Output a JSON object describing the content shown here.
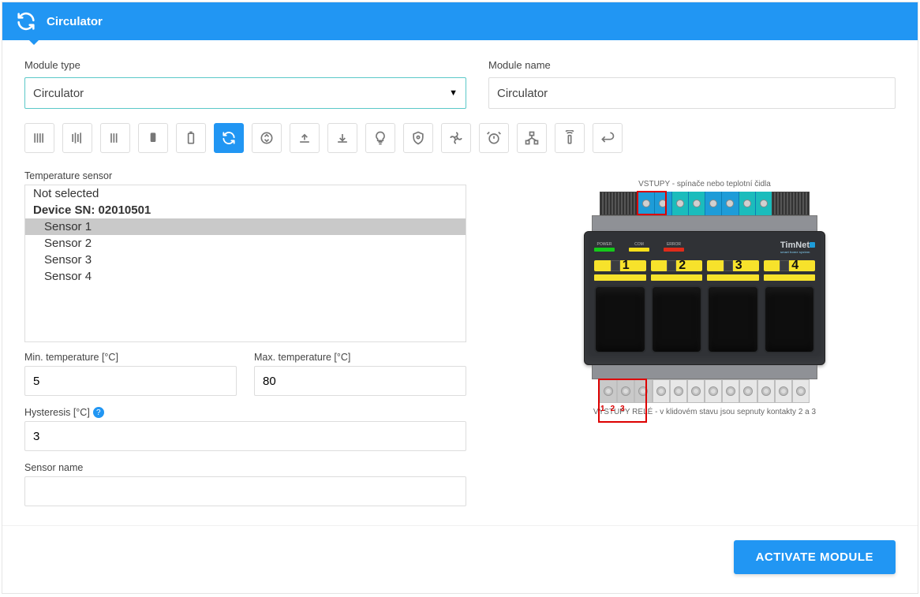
{
  "header": {
    "title": "Circulator"
  },
  "module_type": {
    "label": "Module type",
    "value": "Circulator"
  },
  "module_name": {
    "label": "Module name",
    "value": "Circulator"
  },
  "icons": [
    "barcode-a",
    "barcode-b",
    "barcode-c",
    "device",
    "battery",
    "cycle",
    "updown",
    "upload",
    "download",
    "bulb",
    "shield",
    "fan",
    "alarm",
    "network",
    "remote",
    "return"
  ],
  "selected_icon_index": 5,
  "sensor": {
    "label": "Temperature sensor",
    "rows": [
      {
        "text": "Not selected",
        "type": "row"
      },
      {
        "text": "Device SN: 02010501",
        "type": "group"
      },
      {
        "text": "Sensor 1",
        "type": "child",
        "selected": true
      },
      {
        "text": "Sensor 2",
        "type": "child"
      },
      {
        "text": "Sensor 3",
        "type": "child"
      },
      {
        "text": "Sensor 4",
        "type": "child"
      }
    ]
  },
  "min_t": {
    "label": "Min. temperature [°C]",
    "value": "5"
  },
  "max_t": {
    "label": "Max. temperature [°C]",
    "value": "80"
  },
  "hyst": {
    "label": "Hysteresis [°C]",
    "value": "3"
  },
  "sname": {
    "label": "Sensor name",
    "value": ""
  },
  "device": {
    "top_caption": "VSTUPY - spínače nebo teplotní čidla",
    "bottom_caption": "VÝSTUPY RELÉ - v klidovém stavu jsou sepnuty kontakty 2 a 3",
    "brand": "TimNet",
    "leds": {
      "power": "POWER",
      "com": "COM",
      "error": "ERROR"
    },
    "channels": [
      "1",
      "2",
      "3",
      "4"
    ],
    "relay_nums": [
      "1",
      "2",
      "3"
    ]
  },
  "footer": {
    "activate": "ACTIVATE MODULE"
  }
}
